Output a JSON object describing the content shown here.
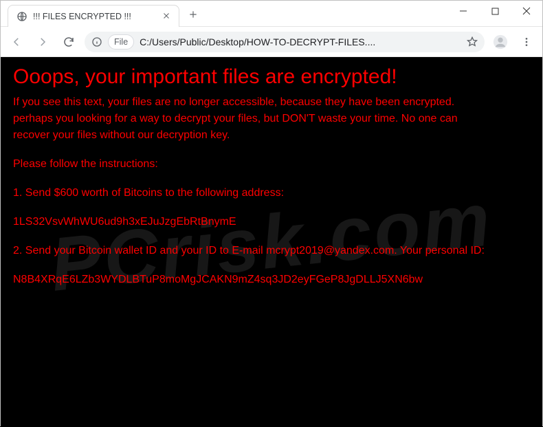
{
  "tab": {
    "title": "!!! FILES ENCRYPTED !!!"
  },
  "address": {
    "chip_label": "File",
    "url": "C:/Users/Public/Desktop/HOW-TO-DECRYPT-FILES...."
  },
  "page": {
    "headline": "Ooops, your important files are encrypted!",
    "p1a": "If you see this text, your files are no longer accessible, because they have been encrypted.",
    "p1b": "perhaps you looking for a way to decrypt your files, but DON'T waste your time. No one can",
    "p1c": "recover your files without our decryption key.",
    "p2": "Please follow the instructions:",
    "p3": "1. Send $600 worth of Bitcoins to the following address:",
    "btc": "1LS32VsvWhWU6ud9h3xEJuJzgEbRtBnymE",
    "p4": "2. Send your Bitcoin wallet ID and your ID to E-mail mcrypt2019@yandex.com. Your personal ID:",
    "pid": "N8B4XRqE6LZb3WYDLBTuP8moMgJCAKN9mZ4sq3JD2eyFGeP8JgDLLJ5XN6bw"
  },
  "watermark": "PCrisk.com"
}
